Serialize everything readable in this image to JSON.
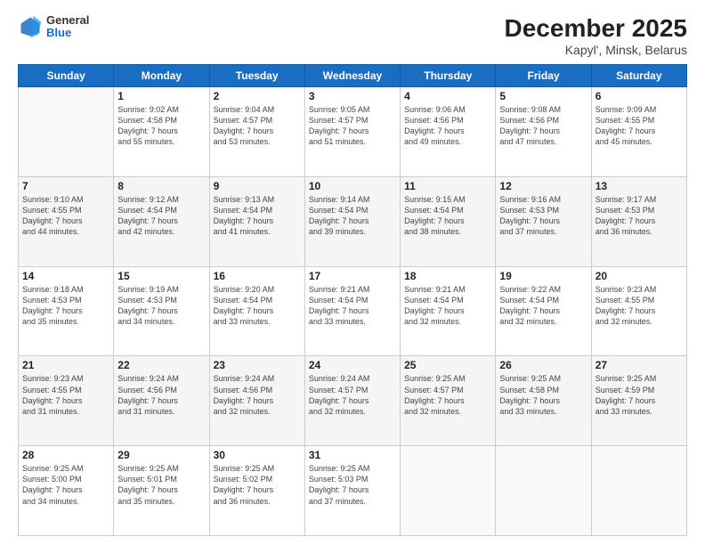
{
  "header": {
    "logo_line1": "General",
    "logo_line2": "Blue",
    "title": "December 2025",
    "subtitle": "Kapyl', Minsk, Belarus"
  },
  "days_of_week": [
    "Sunday",
    "Monday",
    "Tuesday",
    "Wednesday",
    "Thursday",
    "Friday",
    "Saturday"
  ],
  "weeks": [
    [
      {
        "num": "",
        "info": ""
      },
      {
        "num": "1",
        "info": "Sunrise: 9:02 AM\nSunset: 4:58 PM\nDaylight: 7 hours\nand 55 minutes."
      },
      {
        "num": "2",
        "info": "Sunrise: 9:04 AM\nSunset: 4:57 PM\nDaylight: 7 hours\nand 53 minutes."
      },
      {
        "num": "3",
        "info": "Sunrise: 9:05 AM\nSunset: 4:57 PM\nDaylight: 7 hours\nand 51 minutes."
      },
      {
        "num": "4",
        "info": "Sunrise: 9:06 AM\nSunset: 4:56 PM\nDaylight: 7 hours\nand 49 minutes."
      },
      {
        "num": "5",
        "info": "Sunrise: 9:08 AM\nSunset: 4:56 PM\nDaylight: 7 hours\nand 47 minutes."
      },
      {
        "num": "6",
        "info": "Sunrise: 9:09 AM\nSunset: 4:55 PM\nDaylight: 7 hours\nand 45 minutes."
      }
    ],
    [
      {
        "num": "7",
        "info": "Sunrise: 9:10 AM\nSunset: 4:55 PM\nDaylight: 7 hours\nand 44 minutes."
      },
      {
        "num": "8",
        "info": "Sunrise: 9:12 AM\nSunset: 4:54 PM\nDaylight: 7 hours\nand 42 minutes."
      },
      {
        "num": "9",
        "info": "Sunrise: 9:13 AM\nSunset: 4:54 PM\nDaylight: 7 hours\nand 41 minutes."
      },
      {
        "num": "10",
        "info": "Sunrise: 9:14 AM\nSunset: 4:54 PM\nDaylight: 7 hours\nand 39 minutes."
      },
      {
        "num": "11",
        "info": "Sunrise: 9:15 AM\nSunset: 4:54 PM\nDaylight: 7 hours\nand 38 minutes."
      },
      {
        "num": "12",
        "info": "Sunrise: 9:16 AM\nSunset: 4:53 PM\nDaylight: 7 hours\nand 37 minutes."
      },
      {
        "num": "13",
        "info": "Sunrise: 9:17 AM\nSunset: 4:53 PM\nDaylight: 7 hours\nand 36 minutes."
      }
    ],
    [
      {
        "num": "14",
        "info": "Sunrise: 9:18 AM\nSunset: 4:53 PM\nDaylight: 7 hours\nand 35 minutes."
      },
      {
        "num": "15",
        "info": "Sunrise: 9:19 AM\nSunset: 4:53 PM\nDaylight: 7 hours\nand 34 minutes."
      },
      {
        "num": "16",
        "info": "Sunrise: 9:20 AM\nSunset: 4:54 PM\nDaylight: 7 hours\nand 33 minutes."
      },
      {
        "num": "17",
        "info": "Sunrise: 9:21 AM\nSunset: 4:54 PM\nDaylight: 7 hours\nand 33 minutes."
      },
      {
        "num": "18",
        "info": "Sunrise: 9:21 AM\nSunset: 4:54 PM\nDaylight: 7 hours\nand 32 minutes."
      },
      {
        "num": "19",
        "info": "Sunrise: 9:22 AM\nSunset: 4:54 PM\nDaylight: 7 hours\nand 32 minutes."
      },
      {
        "num": "20",
        "info": "Sunrise: 9:23 AM\nSunset: 4:55 PM\nDaylight: 7 hours\nand 32 minutes."
      }
    ],
    [
      {
        "num": "21",
        "info": "Sunrise: 9:23 AM\nSunset: 4:55 PM\nDaylight: 7 hours\nand 31 minutes."
      },
      {
        "num": "22",
        "info": "Sunrise: 9:24 AM\nSunset: 4:56 PM\nDaylight: 7 hours\nand 31 minutes."
      },
      {
        "num": "23",
        "info": "Sunrise: 9:24 AM\nSunset: 4:56 PM\nDaylight: 7 hours\nand 32 minutes."
      },
      {
        "num": "24",
        "info": "Sunrise: 9:24 AM\nSunset: 4:57 PM\nDaylight: 7 hours\nand 32 minutes."
      },
      {
        "num": "25",
        "info": "Sunrise: 9:25 AM\nSunset: 4:57 PM\nDaylight: 7 hours\nand 32 minutes."
      },
      {
        "num": "26",
        "info": "Sunrise: 9:25 AM\nSunset: 4:58 PM\nDaylight: 7 hours\nand 33 minutes."
      },
      {
        "num": "27",
        "info": "Sunrise: 9:25 AM\nSunset: 4:59 PM\nDaylight: 7 hours\nand 33 minutes."
      }
    ],
    [
      {
        "num": "28",
        "info": "Sunrise: 9:25 AM\nSunset: 5:00 PM\nDaylight: 7 hours\nand 34 minutes."
      },
      {
        "num": "29",
        "info": "Sunrise: 9:25 AM\nSunset: 5:01 PM\nDaylight: 7 hours\nand 35 minutes."
      },
      {
        "num": "30",
        "info": "Sunrise: 9:25 AM\nSunset: 5:02 PM\nDaylight: 7 hours\nand 36 minutes."
      },
      {
        "num": "31",
        "info": "Sunrise: 9:25 AM\nSunset: 5:03 PM\nDaylight: 7 hours\nand 37 minutes."
      },
      {
        "num": "",
        "info": ""
      },
      {
        "num": "",
        "info": ""
      },
      {
        "num": "",
        "info": ""
      }
    ]
  ]
}
